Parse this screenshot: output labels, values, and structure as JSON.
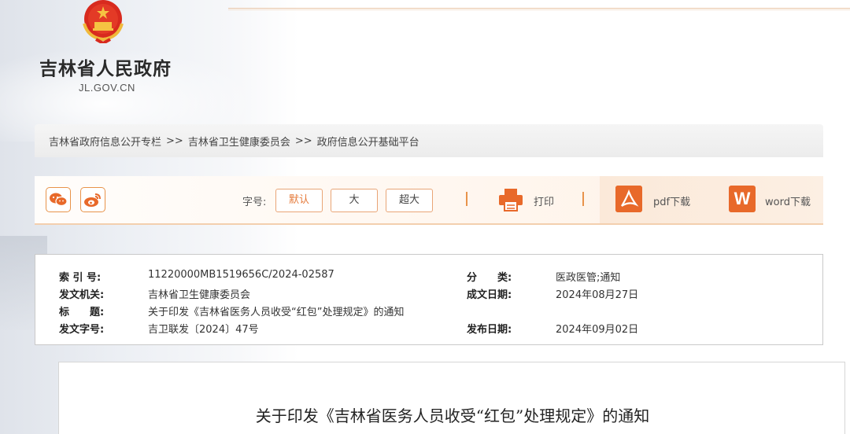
{
  "header": {
    "site_name": "吉林省人民政府",
    "site_domain": "JL.GOV.CN"
  },
  "breadcrumb": {
    "items": [
      "吉林省政府信息公开专栏",
      "吉林省卫生健康委员会",
      "政府信息公开基础平台"
    ],
    "separator": ">>"
  },
  "toolbar": {
    "font_size_label": "字号:",
    "font_sizes": [
      "默认",
      "大",
      "超大"
    ],
    "print_label": "打印",
    "pdf_label": "pdf下载",
    "word_label": "word下载",
    "word_icon_letter": "W",
    "accent_color": "#e8692a"
  },
  "meta": {
    "index_no_key": "索 引 号:",
    "index_no": "11220000MB1519656C/2024-02587",
    "category_key": "分　　类:",
    "category": "医政医管;通知",
    "issuer_key": "发文机关:",
    "issuer": "吉林省卫生健康委员会",
    "created_key": "成文日期:",
    "created": "2024年08月27日",
    "title_key": "标　　题:",
    "title": "关于印发《吉林省医务人员收受“红包”处理规定》的通知",
    "doc_no_key": "发文字号:",
    "doc_no": "吉卫联发〔2024〕47号",
    "published_key": "发布日期:",
    "published": "2024年09月02日"
  },
  "document": {
    "title": "关于印发《吉林省医务人员收受“红包”处理规定》的通知"
  }
}
